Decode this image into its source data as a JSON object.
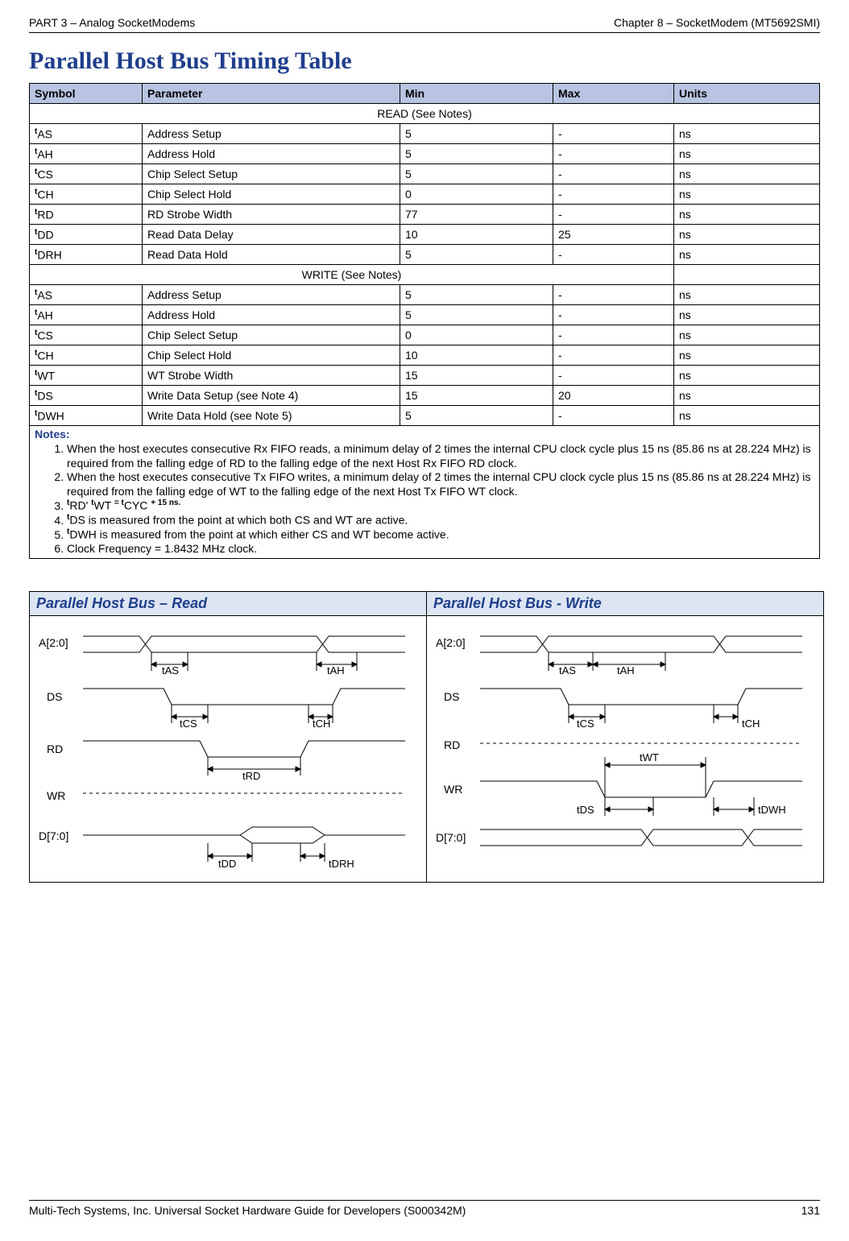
{
  "header": {
    "left": "PART 3 – Analog SocketModems",
    "right": "Chapter 8 – SocketModem (MT5692SMI)"
  },
  "title": "Parallel Host Bus Timing Table",
  "table": {
    "headers": {
      "symbol": "Symbol",
      "parameter": "Parameter",
      "min": "Min",
      "max": "Max",
      "units": "Units"
    },
    "read_section": "READ (See Notes)",
    "write_section": "WRITE (See Notes)",
    "read_rows": [
      {
        "sym": "AS",
        "param": "Address Setup",
        "min": "5",
        "max": "-",
        "units": "ns"
      },
      {
        "sym": "AH",
        "param": "Address Hold",
        "min": "5",
        "max": "-",
        "units": "ns"
      },
      {
        "sym": "CS",
        "param": "Chip Select Setup",
        "min": "5",
        "max": "-",
        "units": "ns"
      },
      {
        "sym": "CH",
        "param": "Chip Select Hold",
        "min": "0",
        "max": "-",
        "units": "ns"
      },
      {
        "sym": "RD",
        "param": "RD Strobe Width",
        "min": "77",
        "max": "-",
        "units": "ns"
      },
      {
        "sym": "DD",
        "param": "Read Data Delay",
        "min": "10",
        "max": "25",
        "units": "ns"
      },
      {
        "sym": "DRH",
        "param": "Read Data Hold",
        "min": "5",
        "max": "-",
        "units": "ns"
      }
    ],
    "write_rows": [
      {
        "sym": "AS",
        "param": "Address Setup",
        "min": "5",
        "max": "-",
        "units": "ns"
      },
      {
        "sym": "AH",
        "param": "Address Hold",
        "min": "5",
        "max": "-",
        "units": "ns"
      },
      {
        "sym": "CS",
        "param": "Chip Select Setup",
        "min": "0",
        "max": "-",
        "units": "ns"
      },
      {
        "sym": "CH",
        "param": "Chip Select Hold",
        "min": "10",
        "max": "-",
        "units": "ns"
      },
      {
        "sym": "WT",
        "param": "WT Strobe Width",
        "min": "15",
        "max": "-",
        "units": "ns"
      },
      {
        "sym": "DS",
        "param": "Write Data Setup (see Note 4)",
        "min": "15",
        "max": "20",
        "units": "ns"
      },
      {
        "sym": "DWH",
        "param": "Write Data Hold (see Note 5)",
        "min": "5",
        "max": "-",
        "units": "ns"
      }
    ]
  },
  "notes": {
    "title": "Notes:",
    "items": [
      "When the host executes consecutive Rx FIFO reads, a minimum delay of 2 times the internal CPU clock cycle plus 15 ns (85.86 ns at 28.224 MHz) is required from the falling edge of RD to the falling edge of the next Host Rx FIFO RD clock.",
      "When the host executes consecutive Tx FIFO writes, a minimum delay of 2 times the internal CPU clock cycle plus 15 ns (85.86 ns at 28.224 MHz) is required from the falling edge of WT to the falling edge of the next Host Tx FIFO WT clock.",
      "tRD' tWT = tCYC + 15 ns.",
      "tDS is measured from the point at which both CS and WT are active.",
      "tDWH is measured from the point at which either CS and WT become active.",
      "Clock Frequency = 1.8432 MHz clock."
    ]
  },
  "diagrams": {
    "read_title": "Parallel Host Bus – Read",
    "write_title": "Parallel Host Bus - Write",
    "signals": {
      "addr": "A[2:0]",
      "ds": "DS",
      "rd": "RD",
      "wr": "WR",
      "data": "D[7:0]"
    },
    "labels": {
      "tAS": "tAS",
      "tAH": "tAH",
      "tCS": "tCS",
      "tCH": "tCH",
      "tRD": "tRD",
      "tWT": "tWT",
      "tDD": "tDD",
      "tDRH": "tDRH",
      "tDS": "tDS",
      "tDWH": "tDWH"
    }
  },
  "footer": {
    "left": "Multi-Tech Systems, Inc. Universal Socket Hardware Guide for Developers (S000342M)",
    "right": "131"
  }
}
